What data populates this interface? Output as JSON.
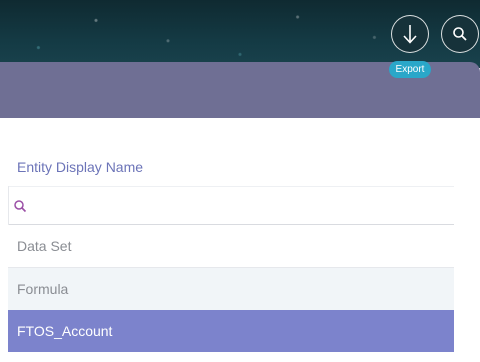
{
  "header": {
    "export_tooltip": "Export",
    "export_icon": "download-arrow-icon",
    "search_icon": "search-icon"
  },
  "grid": {
    "column_header": "Entity Display Name",
    "filter_icon": "search-icon",
    "filter_value": "",
    "rows": [
      {
        "label": "Data Set"
      },
      {
        "label": "Formula"
      },
      {
        "label": "FTOS_Account"
      }
    ],
    "selected_row": 2
  },
  "colors": {
    "banner": "#6f6f94",
    "accent": "#7c83cc",
    "tooltip": "#2aa7c9",
    "header_text": "#6c74b8"
  }
}
